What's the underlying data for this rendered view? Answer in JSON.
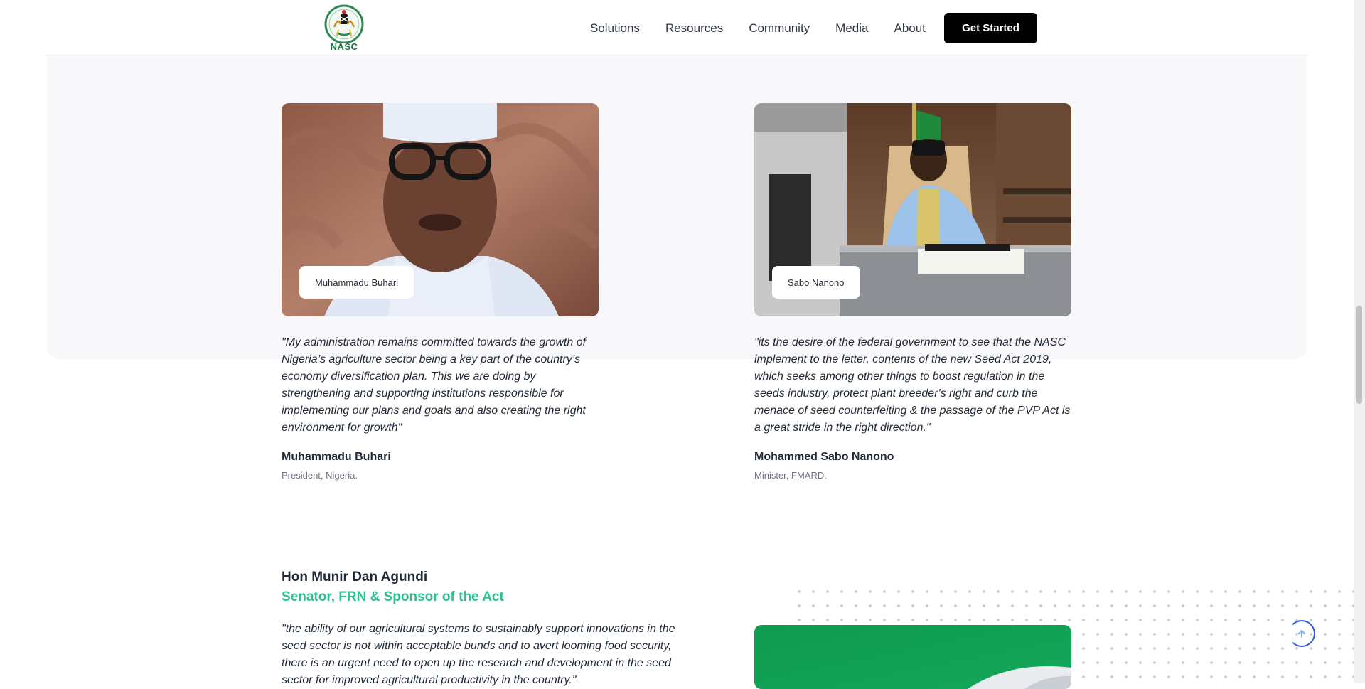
{
  "header": {
    "logo_text": "NASC",
    "nav": [
      "Solutions",
      "Resources",
      "Community",
      "Media",
      "About"
    ],
    "cta_label": "Get Started"
  },
  "testimonials": [
    {
      "chip": "Muhammadu Buhari",
      "quote": "\"My administration remains committed towards the growth of Nigeria’s agriculture sector being a key part of the country’s economy diversification plan. This we are doing by strengthening and supporting institutions responsible for implementing our plans and goals and also creating the right environment for growth\"",
      "name": "Muhammadu Buhari",
      "role": "President, Nigeria."
    },
    {
      "chip": "Sabo Nanono",
      "quote": "\"its the desire of the federal government to see that the NASC implement to the letter, contents of the new Seed Act 2019, which seeks among other things to boost regulation in the seeds industry, protect plant breeder's right and curb the menace of seed counterfeiting & the passage of the PVP Act is a great stride in the right direction.\"",
      "name": "Mohammed Sabo Nanono",
      "role": "Minister, FMARD."
    }
  ],
  "sponsor": {
    "name": "Hon Munir Dan Agundi",
    "title": "Senator, FRN & Sponsor of the Act",
    "quote": "\"the ability of our agricultural systems to sustainably support innovations in the seed sector is not within acceptable bunds and to avert looming food security, there is an urgent need to open up the research and development in the seed sector for improved agricultural productivity in the country.\""
  },
  "colors": {
    "accent_green": "#2cc28e",
    "cta_background": "#000000",
    "panel_background": "#f8f8fa",
    "scroll_top_ring": "#2e5bd9"
  },
  "icons": {
    "logo": "nasc-coat-of-arms-icon",
    "scroll_top": "arrow-up-icon"
  }
}
